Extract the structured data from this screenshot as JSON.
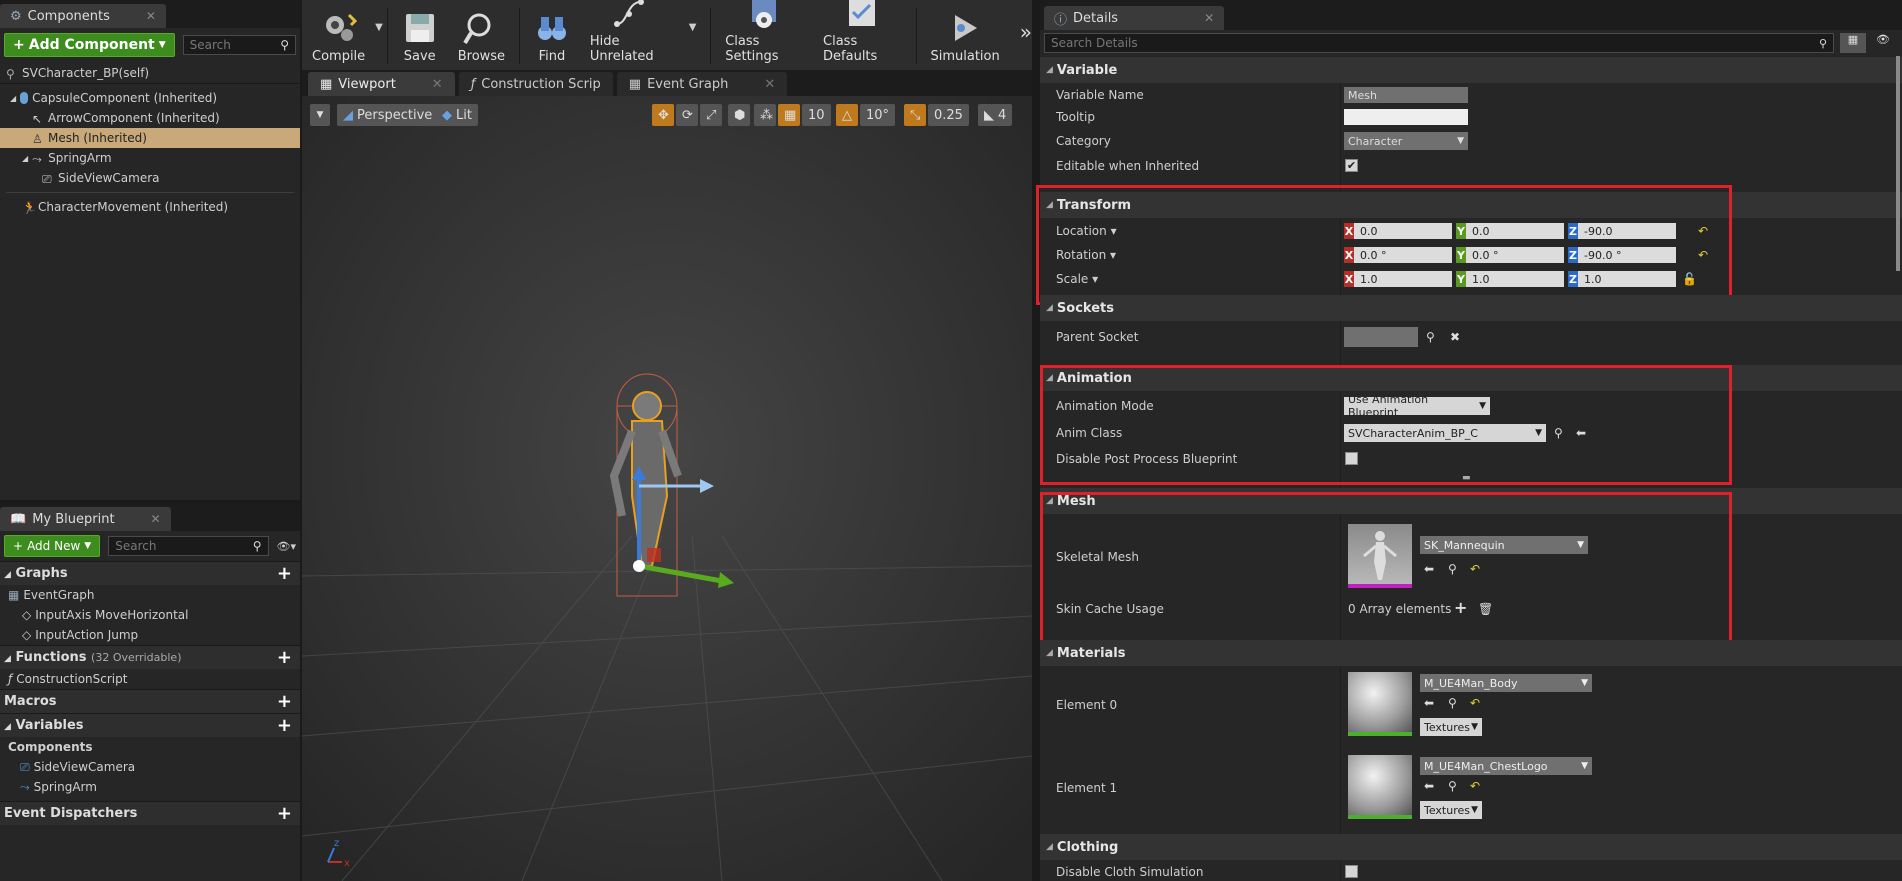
{
  "components_panel": {
    "tab_title": "Components",
    "add_component_label": "Add Component",
    "search_placeholder": "Search",
    "self_label": "SVCharacter_BP(self)",
    "tree": [
      {
        "label": "CapsuleComponent (Inherited)",
        "icon": "capsule-icon",
        "selected": false
      },
      {
        "label": "ArrowComponent (Inherited)",
        "icon": "arrow-icon",
        "selected": false
      },
      {
        "label": "Mesh (Inherited)",
        "icon": "mesh-icon",
        "selected": true
      },
      {
        "label": "SpringArm",
        "icon": "spring-arm-icon",
        "selected": false
      },
      {
        "label": "SideViewCamera",
        "icon": "camera-icon",
        "selected": false
      },
      {
        "label": "CharacterMovement (Inherited)",
        "icon": "movement-icon",
        "selected": false
      }
    ]
  },
  "my_blueprint": {
    "tab_title": "My Blueprint",
    "add_new_label": "Add New",
    "search_placeholder": "Search",
    "sections": {
      "graphs": "Graphs",
      "functions": "Functions",
      "functions_count": "(32 Overridable)",
      "macros": "Macros",
      "variables": "Variables",
      "components": "Components",
      "event_dispatchers": "Event Dispatchers"
    },
    "graph_items": [
      "EventGraph",
      "InputAxis MoveHorizontal",
      "InputAction Jump"
    ],
    "function_items": [
      "ConstructionScript"
    ],
    "component_items": [
      "SideViewCamera",
      "SpringArm"
    ]
  },
  "toolbar": {
    "buttons": [
      "Compile",
      "Save",
      "Browse",
      "Find",
      "Hide Unrelated",
      "Class Settings",
      "Class Defaults",
      "Simulation"
    ]
  },
  "viewport": {
    "tabs": [
      "Viewport",
      "Construction Scrip",
      "Event Graph"
    ],
    "perspective_label": "Perspective",
    "lit_label": "Lit",
    "grid_snap": "10",
    "rot_snap": "10°",
    "scale_snap": "0.25",
    "camera_speed": "4"
  },
  "details": {
    "tab_title": "Details",
    "search_placeholder": "Search Details",
    "variable": {
      "header": "Variable",
      "name_label": "Variable Name",
      "name_value": "Mesh",
      "tooltip_label": "Tooltip",
      "tooltip_value": "",
      "category_label": "Category",
      "category_value": "Character",
      "editable_label": "Editable when Inherited"
    },
    "transform": {
      "header": "Transform",
      "location_label": "Location",
      "rotation_label": "Rotation",
      "scale_label": "Scale",
      "location": [
        "0.0",
        "0.0",
        "-90.0"
      ],
      "rotation": [
        "0.0 °",
        "0.0 °",
        "-90.0 °"
      ],
      "scale": [
        "1.0",
        "1.0",
        "1.0"
      ]
    },
    "sockets": {
      "header": "Sockets",
      "parent_socket_label": "Parent Socket"
    },
    "animation": {
      "header": "Animation",
      "mode_label": "Animation Mode",
      "mode_value": "Use Animation Blueprint",
      "class_label": "Anim Class",
      "class_value": "SVCharacterAnim_BP_C",
      "disable_pp_label": "Disable Post Process Blueprint"
    },
    "mesh": {
      "header": "Mesh",
      "skeletal_label": "Skeletal Mesh",
      "skeletal_value": "SK_Mannequin",
      "skin_cache_label": "Skin Cache Usage",
      "skin_cache_value": "0 Array elements"
    },
    "materials": {
      "header": "Materials",
      "element0_label": "Element 0",
      "element0_value": "M_UE4Man_Body",
      "element1_label": "Element 1",
      "element1_value": "M_UE4Man_ChestLogo",
      "textures_label": "Textures"
    },
    "clothing": {
      "header": "Clothing",
      "disable_cloth_label": "Disable Cloth Simulation"
    }
  }
}
